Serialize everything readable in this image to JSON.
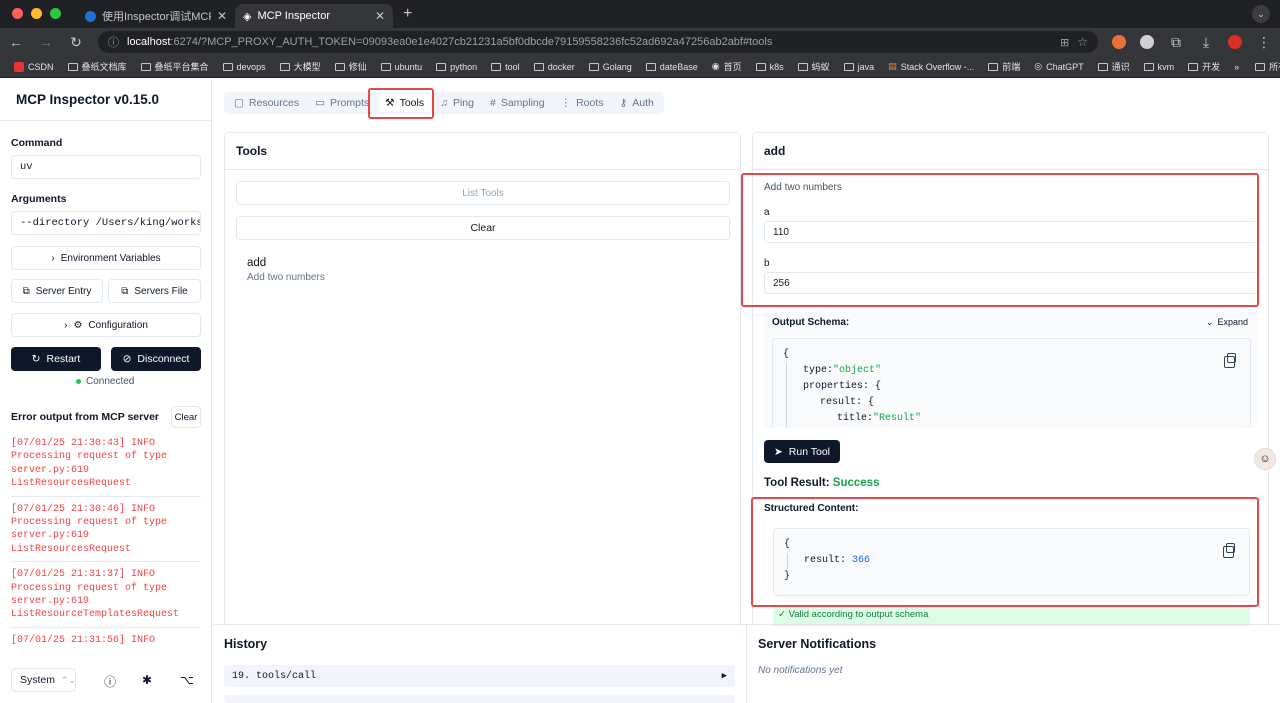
{
  "browser": {
    "tabs": [
      {
        "title": "使用Inspector调试MCP服务 -",
        "active": false
      },
      {
        "title": "MCP Inspector",
        "active": true
      }
    ],
    "url_host": "localhost",
    "url_rest": ":6274/?MCP_PROXY_AUTH_TOKEN=09093ea0e1e4027cb21231a5bf0dbcde79159558236fc52ad692a47256ab2abf#tools",
    "bookmarks": [
      "CSDN",
      "叠纸文档库",
      "叠纸平台集合",
      "devops",
      "大模型",
      "修仙",
      "ubuntu",
      "python",
      "tool",
      "docker",
      "Golang",
      "dateBase",
      "首页",
      "k8s",
      "蚂蚁",
      "java",
      "Stack Overflow -...",
      "前端",
      "ChatGPT",
      "通识",
      "kvm",
      "开发"
    ],
    "bookmarks_more": "»",
    "all_bookmarks": "所有书签",
    "colors": {
      "tabbar": "#202124",
      "toolbar": "#35363a"
    }
  },
  "sidebar": {
    "title": "MCP Inspector v0.15.0",
    "command_label": "Command",
    "command_value": "uv",
    "arguments_label": "Arguments",
    "arguments_value": "--directory /Users/king/workspa",
    "env_button": "Environment Variables",
    "server_entry_button": "Server Entry",
    "servers_file_button": "Servers File",
    "configuration_button": "Configuration",
    "restart_button": "Restart",
    "disconnect_button": "Disconnect",
    "status": "Connected",
    "error_title": "Error output from MCP server",
    "clear_button": "Clear",
    "logs": [
      {
        "line1": "[07/01/25 21:30:43] INFO",
        "line2": "Processing request of type",
        "line3": "server.py:619",
        "line4": "ListResourcesRequest"
      },
      {
        "line1": "[07/01/25 21:30:46] INFO",
        "line2": "Processing request of type",
        "line3": "server.py:619",
        "line4": "ListResourcesRequest"
      },
      {
        "line1": "[07/01/25 21:31:37] INFO",
        "line2": "Processing request of type",
        "line3": "server.py:619",
        "line4": "ListResourceTemplatesRequest"
      },
      {
        "line1": "[07/01/25 21:31:56] INFO",
        "line2": "",
        "line3": "",
        "line4": ""
      }
    ],
    "theme_select": "System"
  },
  "main": {
    "tabs": [
      "Resources",
      "Prompts",
      "Tools",
      "Ping",
      "Sampling",
      "Roots",
      "Auth"
    ],
    "active_tab": "Tools",
    "tools_panel": {
      "title": "Tools",
      "list_button": "List Tools",
      "clear_button": "Clear",
      "tool_name": "add",
      "tool_desc": "Add two numbers"
    },
    "detail_panel": {
      "title": "add",
      "description": "Add two numbers",
      "a_label": "a",
      "a_value": "110",
      "b_label": "b",
      "b_value": "256",
      "output_schema_label": "Output Schema:",
      "expand_label": "Expand",
      "schema_lines": {
        "open": "{",
        "type_key": "type:",
        "type_val": "\"object\"",
        "props_key": "properties:",
        "brace": "{",
        "result_key": "result:",
        "title_key": "title:",
        "title_val": "\"Result\""
      },
      "run_button": "Run Tool",
      "result_label": "Tool Result:",
      "result_status": "Success",
      "structured_label": "Structured Content:",
      "structured": {
        "open": "{",
        "key": "result:",
        "value": "366",
        "close": "}"
      },
      "valid_text": "✓ Valid according to output schema"
    },
    "history": {
      "title": "History",
      "items": [
        {
          "label": "19. tools/call",
          "arrow": "▶"
        }
      ]
    },
    "notifications": {
      "title": "Server Notifications",
      "empty": "No notifications yet"
    },
    "colors": {
      "highlight": "#e54848",
      "success": "#16a34a",
      "primary": "#0f172a"
    }
  }
}
